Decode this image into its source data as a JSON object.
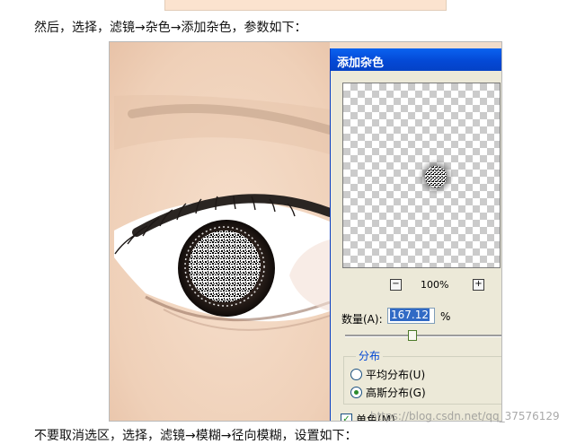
{
  "article": {
    "intro": "然后，选择，滤镜→杂色→添加杂色，参数如下：",
    "bottom": "不要取消选区，选择，滤镜→模糊→径向模糊，设置如下："
  },
  "dialog": {
    "title": "添加杂色",
    "zoom_out_symbol": "−",
    "zoom_level": "100%",
    "zoom_in_symbol": "+",
    "amount_label": "数量(A):",
    "amount_value": "167.12",
    "amount_unit": "%",
    "amount_fraction": 0.4,
    "distribution_group": "分布",
    "uniform_label": "平均分布(U)",
    "gaussian_label": "高斯分布(G)",
    "selected_distribution": "gaussian",
    "monochrome_label": "单色(M)",
    "monochrome_checked": true
  },
  "watermark": "https://blog.csdn.net/qq_37576129",
  "colors": {
    "titlebar": "#0a5ce6",
    "dialog_bg": "#ece9d8",
    "group_label": "#0046d5"
  }
}
